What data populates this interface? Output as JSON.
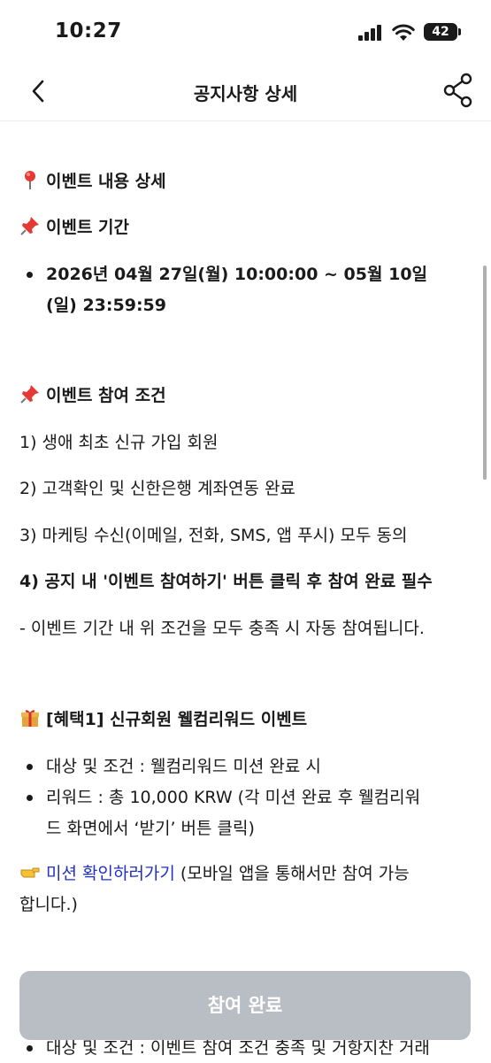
{
  "status_bar": {
    "time": "10:27",
    "battery_level": "42"
  },
  "header": {
    "title": "공지사항 상세",
    "back_icon": "chevron-left-icon",
    "share_icon": "share-icon"
  },
  "content": {
    "section_title": "이벤트 내용 상세",
    "period": {
      "heading": "이벤트 기간",
      "text_line1": "2026년 04월 27일(월) 10:00:00 ~ 05월 10일",
      "text_line2": "(일) 23:59:59"
    },
    "conditions": {
      "heading": "이벤트 참여 조건",
      "items": [
        "1) 생애 최초 신규 가입 회원",
        "2) 고객확인 및 신한은행 계좌연동 완료",
        "3) 마케팅 수신(이메일, 전화, SMS, 앱 푸시) 모두 동의",
        "4) 공지 내 '이벤트 참여하기' 버튼 클릭 후 참여 완료 필수"
      ],
      "note": "- 이벤트 기간 내 위 조건을 모두 충족 시 자동 참여됩니다."
    },
    "benefit1": {
      "heading": "[혜택1] 신규회원 웰컴리워드 이벤트",
      "bullet1": "대상 및 조건 : 웰컴리워드 미션 완료 시",
      "bullet2_line1": "리워드 : 총 10,000 KRW (각 미션 완료 후 웰컴리워",
      "bullet2_line2": "드 화면에서 ‘받기’ 버튼 클릭)",
      "link_text": "미션 확인하러가기",
      "link_suffix": " (모바일 앱을 통해서만 참여 가능",
      "link_line2": "합니다.)"
    },
    "partial_bullet": "대상 및 조건 : 이벤트 참여 조건 충족 및 거항지찬 거래"
  },
  "cta": {
    "label": "참여 완료"
  }
}
